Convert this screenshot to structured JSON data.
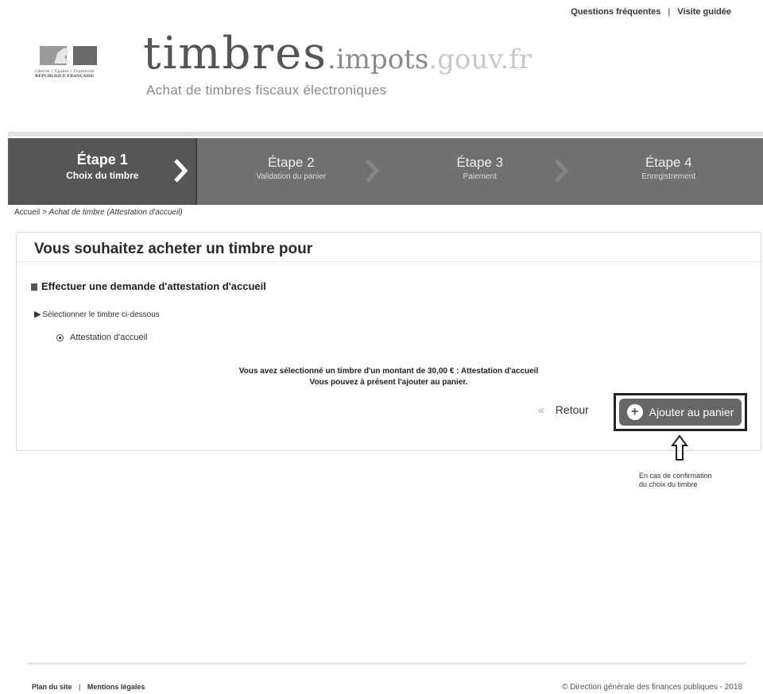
{
  "top_links": {
    "faq": "Questions fréquentes",
    "separator": "|",
    "tour": "Visite guidée"
  },
  "logo": {
    "motto": "Liberté • Égalité • Fraternité",
    "republic": "RÉPUBLIQUE FRANÇAISE"
  },
  "brand": {
    "name": "timbres",
    "domain_main": ".impots",
    "domain_rest": ".gouv.fr",
    "tagline": "Achat de timbres fiscaux électroniques"
  },
  "steps": [
    {
      "title": "Étape 1",
      "subtitle": "Choix du timbre",
      "active": true
    },
    {
      "title": "Étape 2",
      "subtitle": "Validation du panier",
      "active": false
    },
    {
      "title": "Étape 3",
      "subtitle": "Paiement",
      "active": false
    },
    {
      "title": "Étape 4",
      "subtitle": "Enregistrement",
      "active": false
    }
  ],
  "breadcrumb": {
    "home": "Accueil",
    "separator": ">",
    "current": "Achat de timbre (Attestation d'accueil)"
  },
  "card": {
    "title": "Vous souhaitez acheter un timbre pour",
    "section": "Effectuer une demande d'attestation d'accueil",
    "subsection": "Sélectionner le timbre ci-dessous",
    "option": "Attestation d'accueil",
    "confirm_line1": "Vous avez sélectionné un timbre d'un montant de 30,00 € : Attestation d'accueil",
    "confirm_line2": "Vous pouvez à présent l'ajouter au panier.",
    "back": "Retour",
    "add": "Ajouter au panier"
  },
  "annotation": {
    "line1": "En cas de confirmation",
    "line2": "du choix du timbre"
  },
  "footer": {
    "sitemap": "Plan du site",
    "separator": "|",
    "legal": "Mentions légales",
    "copyright": "© Direction générale des finances publiques - 2018"
  },
  "colors": {
    "steps_bg": "#707070",
    "active_step_bg": "#565656",
    "button_bg": "#666666"
  }
}
